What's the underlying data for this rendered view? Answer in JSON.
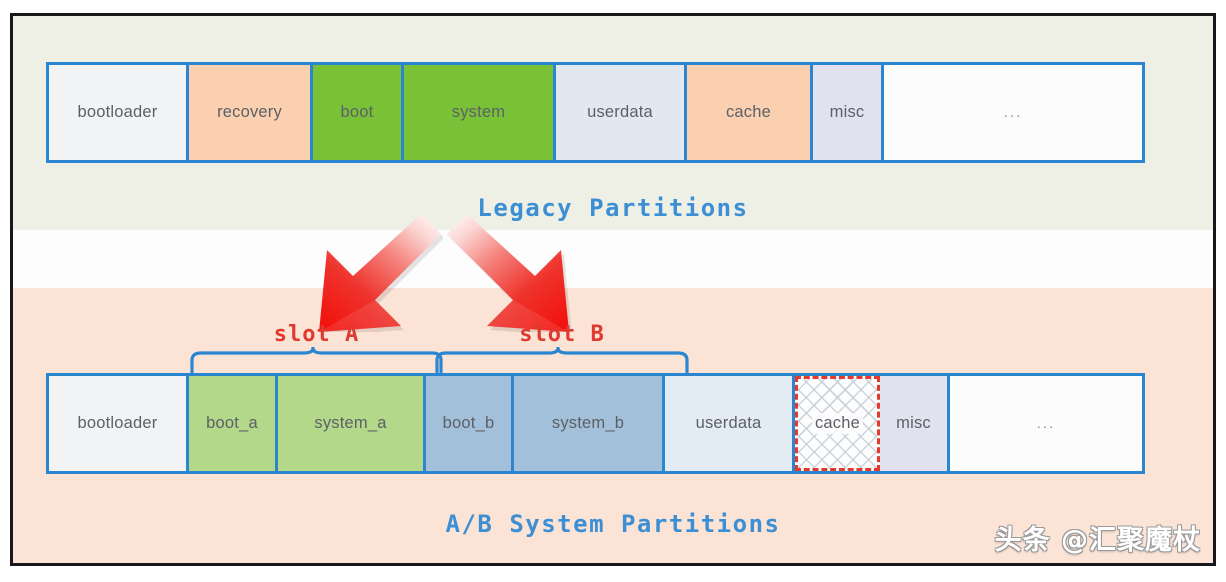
{
  "legacy": {
    "caption": "Legacy Partitions",
    "caption_color": "#3d8fd4",
    "partitions": [
      {
        "label": "bootloader",
        "fill": "#f2f3f5"
      },
      {
        "label": "recovery",
        "fill": "#fad0b1"
      },
      {
        "label": "boot",
        "fill": "#79c238"
      },
      {
        "label": "system",
        "fill": "#79c238"
      },
      {
        "label": "userdata",
        "fill": "#e2e8f0"
      },
      {
        "label": "cache",
        "fill": "#fad0b1"
      },
      {
        "label": "misc",
        "fill": "#e2e1ef"
      },
      {
        "label": "...",
        "fill": "#fcfcfd"
      }
    ]
  },
  "ab": {
    "caption": "A/B System Partitions",
    "caption_color": "#3d8fd4",
    "partitions": [
      {
        "label": "bootloader",
        "fill": "#f2f3f5"
      },
      {
        "label": "boot_a",
        "fill": "#b3d88a"
      },
      {
        "label": "system_a",
        "fill": "#b3d88a"
      },
      {
        "label": "boot_b",
        "fill": "#a2c0d9"
      },
      {
        "label": "system_b",
        "fill": "#a2c0d9"
      },
      {
        "label": "userdata",
        "fill": "#e3ecf4"
      },
      {
        "label": "cache",
        "fill": "#fdfdfd"
      },
      {
        "label": "misc",
        "fill": "#e2e1ef"
      },
      {
        "label": "...",
        "fill": "#fcfcfd"
      }
    ],
    "slots": [
      {
        "name": "slot A",
        "color": "#e0392e"
      },
      {
        "name": "slot B",
        "color": "#e0392e"
      }
    ]
  },
  "arrows": {
    "count": 2,
    "color": "#ef3b34",
    "direction": "down"
  },
  "watermark": {
    "text": "头条 @汇聚魔杖"
  },
  "theme": {
    "partition_border": "#2a86d0",
    "band_legacy_bg": "#eef0e6",
    "band_gap_bg": "#fdfdfd",
    "band_ab_bg": "#fbe3d6",
    "cache_dashed_border": "#e23b2e",
    "frame_border": "#17171c"
  }
}
